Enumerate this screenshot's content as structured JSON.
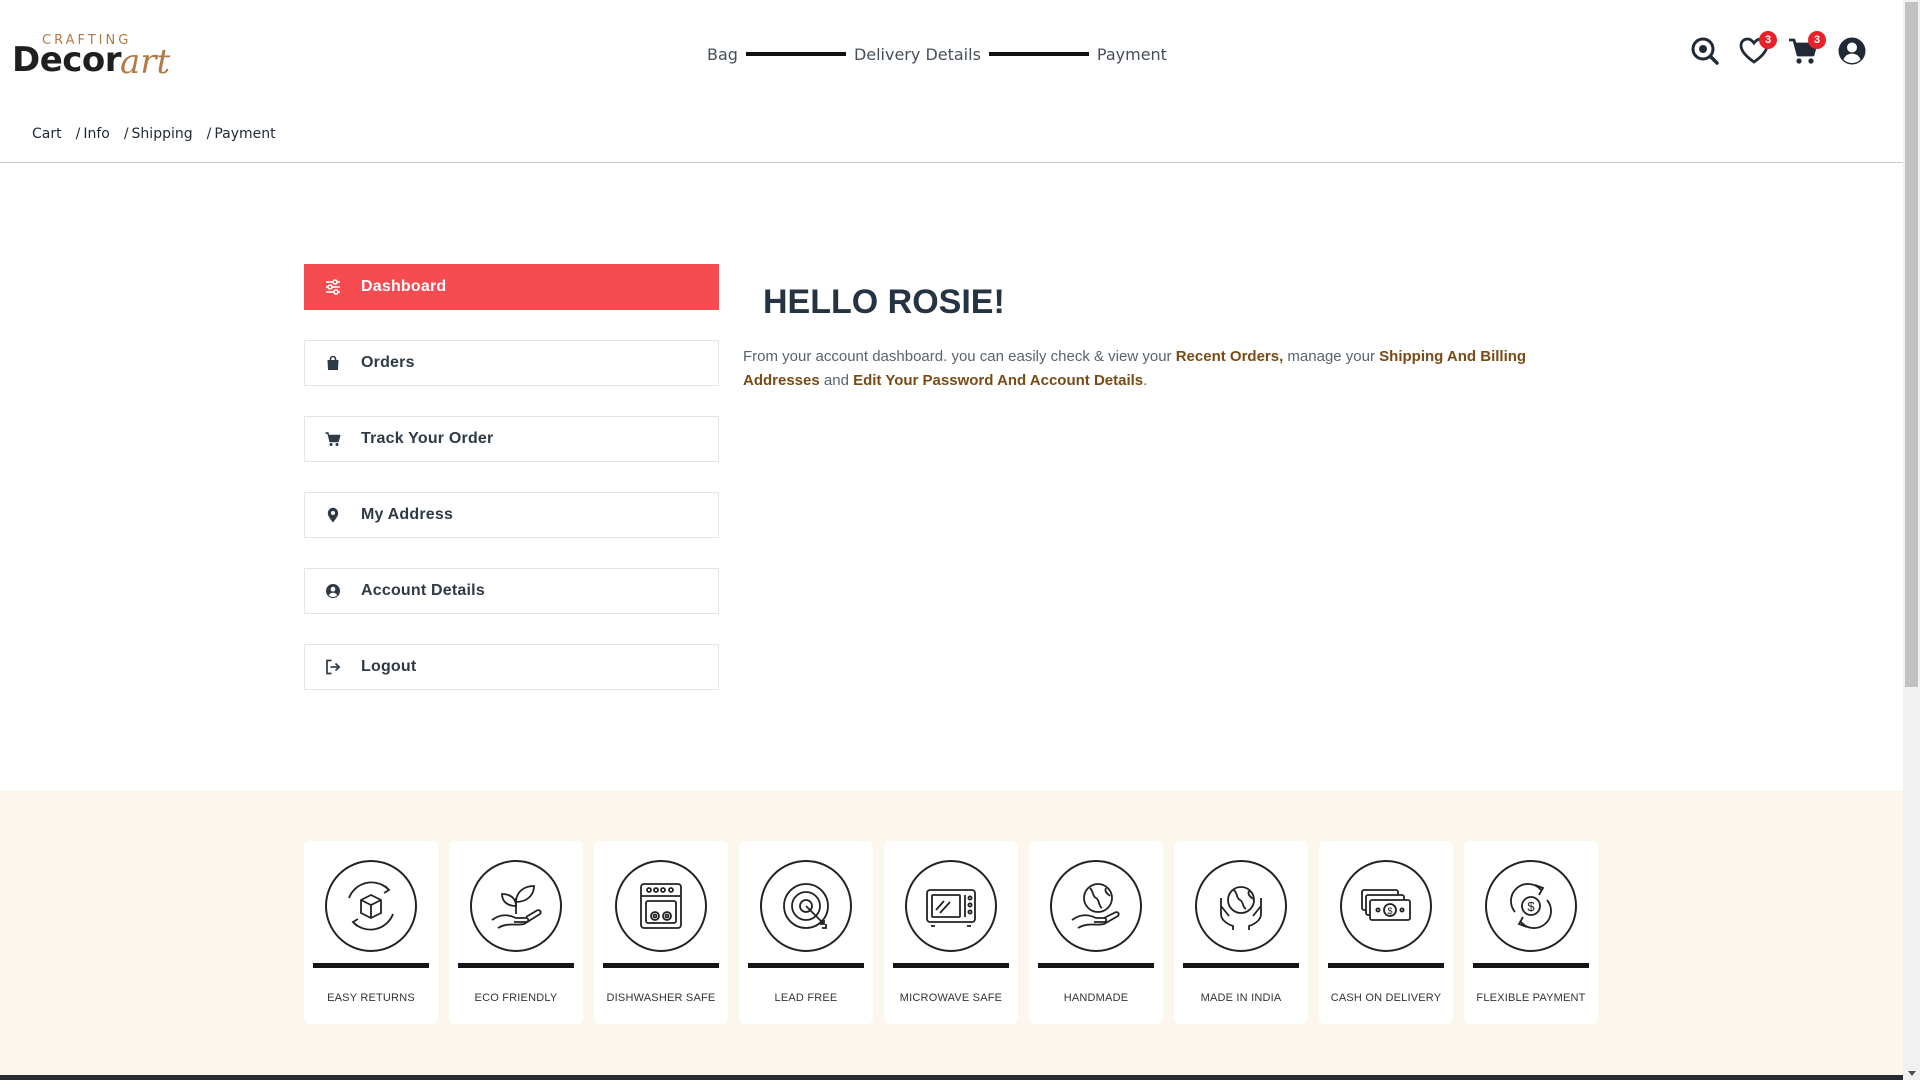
{
  "logo": {
    "crafting": "CRAFTING",
    "decor": "Decor",
    "art": "art"
  },
  "steps": [
    "Bag",
    "Delivery Details",
    "Payment"
  ],
  "header_icons": {
    "wishlist_count": "3",
    "cart_count": "3"
  },
  "breadcrumb": {
    "items": [
      "Cart",
      "Info",
      "Shipping",
      "Payment"
    ],
    "separator": "/"
  },
  "sidebar": {
    "items": [
      {
        "label": "Dashboard",
        "icon": "sliders-icon",
        "active": true
      },
      {
        "label": "Orders",
        "icon": "shopping-bag-icon"
      },
      {
        "label": "Track Your Order",
        "icon": "cart-icon"
      },
      {
        "label": "My Address",
        "icon": "map-pin-icon"
      },
      {
        "label": "Account Details",
        "icon": "user-circle-icon"
      },
      {
        "label": "Logout",
        "icon": "logout-icon"
      }
    ]
  },
  "main": {
    "greeting": "HELLO ROSIE!",
    "intro_1": "From your account dashboard. you can easily check & view your ",
    "link_orders": "Recent Orders,",
    "intro_2": " manage your ",
    "link_addresses": "Shipping And Billing Addresses",
    "intro_3": " and ",
    "link_account": "Edit Your Password And Account Details",
    "intro_4": "."
  },
  "features": [
    {
      "label": "EASY RETURNS",
      "icon": "box-return-icon"
    },
    {
      "label": "ECO FRIENDLY",
      "icon": "plant-hand-icon"
    },
    {
      "label": "DISHWASHER SAFE",
      "icon": "dishwasher-icon"
    },
    {
      "label": "LEAD FREE",
      "icon": "target-icon"
    },
    {
      "label": "MICROWAVE SAFE",
      "icon": "microwave-icon"
    },
    {
      "label": "HANDMADE",
      "icon": "globe-hand-icon"
    },
    {
      "label": "MADE IN INDIA",
      "icon": "globe-hands-icon"
    },
    {
      "label": "CASH ON DELIVERY",
      "icon": "cash-icon"
    },
    {
      "label": "FLEXIBLE PAYMENT",
      "icon": "dollar-cycle-icon"
    }
  ],
  "colors": {
    "accent": "#f74b52",
    "brand": "#b27a45",
    "link": "#7a4b14",
    "band": "#fbf7ec"
  }
}
